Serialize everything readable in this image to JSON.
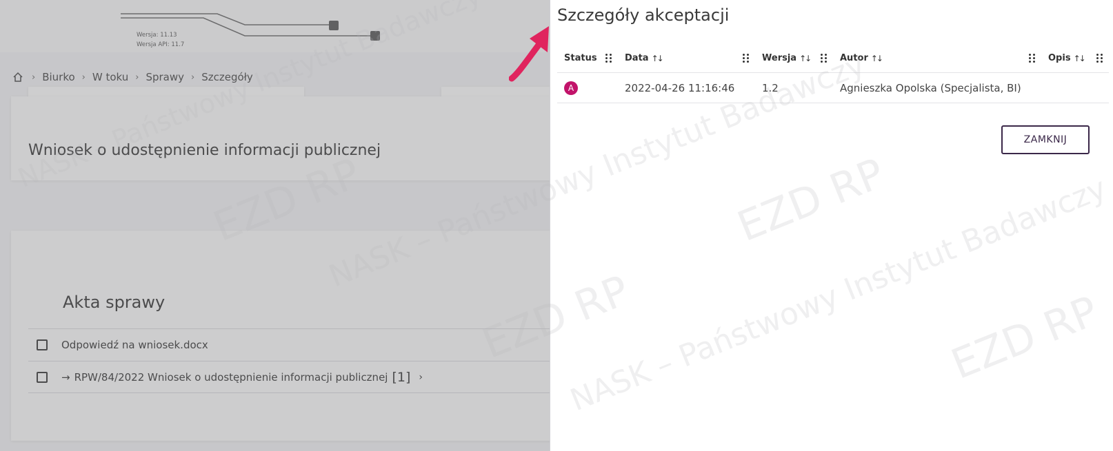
{
  "version": {
    "app": "Wersja: 11.13",
    "api": "Wersja API: 11.7"
  },
  "breadcrumb": {
    "items": [
      "Biurko",
      "W toku",
      "Sprawy",
      "Szczegóły"
    ]
  },
  "case": {
    "title": "Wniosek o udostępnienie informacji publicznej"
  },
  "acts": {
    "title": "Akta sprawy",
    "items": [
      {
        "label": "Odpowiedź na wniosek.docx"
      },
      {
        "label": "RPW/84/2022 Wniosek o udostępnienie informacji publicznej",
        "count": "[1]"
      }
    ]
  },
  "panel": {
    "title": "Szczegóły akceptacji",
    "columns": {
      "status": "Status",
      "data": "Data",
      "wersja": "Wersja",
      "autor": "Autor",
      "opis": "Opis"
    },
    "rows": [
      {
        "status": "A",
        "data": "2022-04-26 11:16:46",
        "wersja": "1.2",
        "autor": "Agnieszka Opolska (Specjalista, BI)",
        "opis": ""
      }
    ],
    "close_label": "ZAMKNIJ"
  },
  "watermark": {
    "text1": "NASK – Państwowy Instytut Badawczy",
    "text2": "EZD RP",
    "text3": "NASK"
  },
  "colors": {
    "accent": "#c2136a",
    "button_border": "#3a2748",
    "arrow": "#e0245e"
  }
}
